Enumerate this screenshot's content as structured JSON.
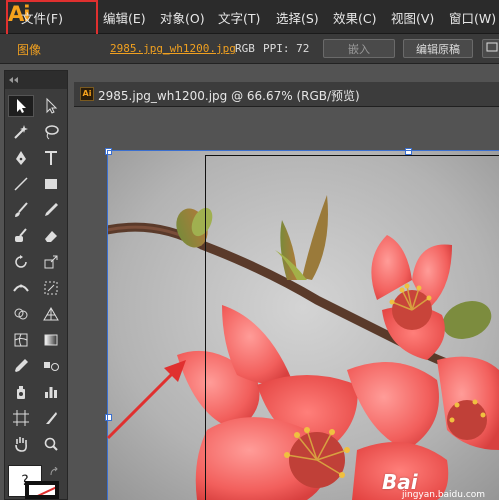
{
  "app": {
    "logo": "Ai"
  },
  "menu": [
    "文件(F)",
    "编辑(E)",
    "对象(O)",
    "文字(T)",
    "选择(S)",
    "效果(C)",
    "视图(V)",
    "窗口(W)"
  ],
  "control_bar": {
    "type_label": "图像",
    "file_link": "2985.jpg_wh1200.jpg",
    "color_mode": "RGB",
    "ppi": "PPI: 72",
    "embed_label": "嵌入",
    "edit_original_label": "编辑原稿"
  },
  "document": {
    "tab_title": "2985.jpg_wh1200.jpg @ 66.67% (RGB/预览)",
    "icon_label": "Ai"
  },
  "toolbar": {
    "fill_stroke_label": "?"
  },
  "watermark": {
    "brand": "Bai",
    "url": "jingyan.baidu.com"
  },
  "colors": {
    "accent": "#f7a21c",
    "highlight_box": "#e0302f",
    "arrow": "#e0302f"
  }
}
